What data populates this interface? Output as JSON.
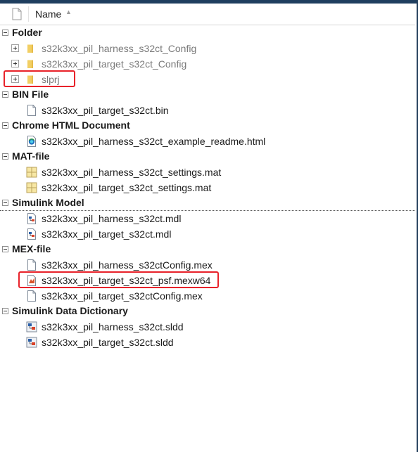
{
  "header": {
    "name_label": "Name",
    "sort_arrow": "▲"
  },
  "groups": [
    {
      "label": "Folder",
      "items": [
        {
          "label": "s32k3xx_pil_harness_s32ct_Config",
          "icon": "folder-icon",
          "expandable": true
        },
        {
          "label": "s32k3xx_pil_target_s32ct_Config",
          "icon": "folder-icon",
          "expandable": true
        },
        {
          "label": "slprj",
          "icon": "folder-icon",
          "expandable": true,
          "highlighted": true
        }
      ]
    },
    {
      "label": "BIN File",
      "items": [
        {
          "label": "s32k3xx_pil_target_s32ct.bin",
          "icon": "document-icon"
        }
      ]
    },
    {
      "label": "Chrome HTML Document",
      "items": [
        {
          "label": "s32k3xx_pil_harness_s32ct_example_readme.html",
          "icon": "chrome-html-icon"
        }
      ]
    },
    {
      "label": "MAT-file",
      "items": [
        {
          "label": "s32k3xx_pil_harness_s32ct_settings.mat",
          "icon": "mat-file-icon"
        },
        {
          "label": "s32k3xx_pil_target_s32ct_settings.mat",
          "icon": "mat-file-icon"
        }
      ]
    },
    {
      "label": "Simulink Model",
      "items": [
        {
          "label": "s32k3xx_pil_harness_s32ct.mdl",
          "icon": "simulink-model-icon"
        },
        {
          "label": "s32k3xx_pil_target_s32ct.mdl",
          "icon": "simulink-model-icon"
        }
      ]
    },
    {
      "label": "MEX-file",
      "items": [
        {
          "label": "s32k3xx_pil_harness_s32ctConfig.mex",
          "icon": "document-icon"
        },
        {
          "label": "s32k3xx_pil_target_s32ct_psf.mexw64",
          "icon": "mex-matlab-icon",
          "highlighted": true
        },
        {
          "label": "s32k3xx_pil_target_s32ctConfig.mex",
          "icon": "document-icon"
        }
      ]
    },
    {
      "label": "Simulink Data Dictionary",
      "items": [
        {
          "label": "s32k3xx_pil_harness_s32ct.sldd",
          "icon": "sldd-icon"
        },
        {
          "label": "s32k3xx_pil_target_s32ct.sldd",
          "icon": "sldd-icon"
        }
      ]
    }
  ],
  "colors": {
    "title_bar": "#1f3e5f",
    "highlight_border": "#e8222a",
    "folder_text": "#7a7a7a",
    "folder_icon": "#f2cf63"
  }
}
